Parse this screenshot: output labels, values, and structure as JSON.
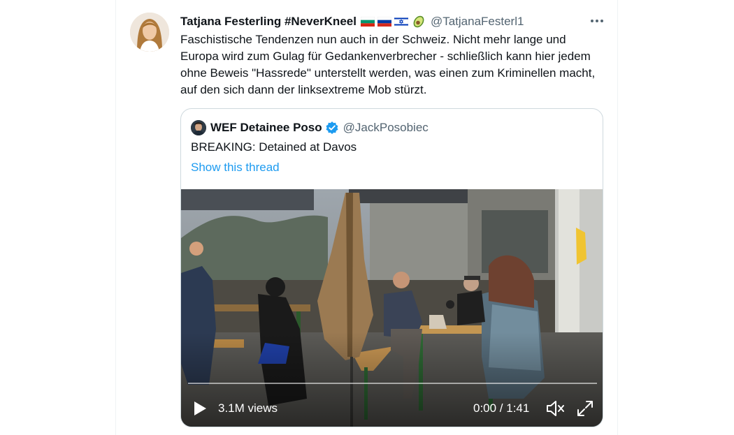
{
  "tweet": {
    "author_name": "Tatjana Festerling #NeverKneel",
    "author_emoji": [
      "flag-bulgaria",
      "flag-russia",
      "flag-israel",
      "avocado"
    ],
    "author_handle": "@TatjanaFesterl1",
    "text": "Faschistische Tendenzen nun auch in der Schweiz. Nicht mehr lange und Europa wird zum Gulag für Gedankenverbrecher - schließlich kann hier jedem ohne Beweis \"Hassrede\" unterstellt werden, was einen zum Kriminellen macht, auf den sich dann der linksextreme Mob stürzt."
  },
  "quoted": {
    "author_name": "WEF Detainee Poso",
    "verified": true,
    "author_handle": "@JackPosobiec",
    "text": "BREAKING: Detained at Davos",
    "thread_link": "Show this thread",
    "video": {
      "views": "3.1M views",
      "time": "0:00 / 1:41",
      "progress": 0
    }
  },
  "colors": {
    "text": "#0f1419",
    "secondary": "#536471",
    "link": "#1d9bf0",
    "border": "#cfd9de"
  }
}
